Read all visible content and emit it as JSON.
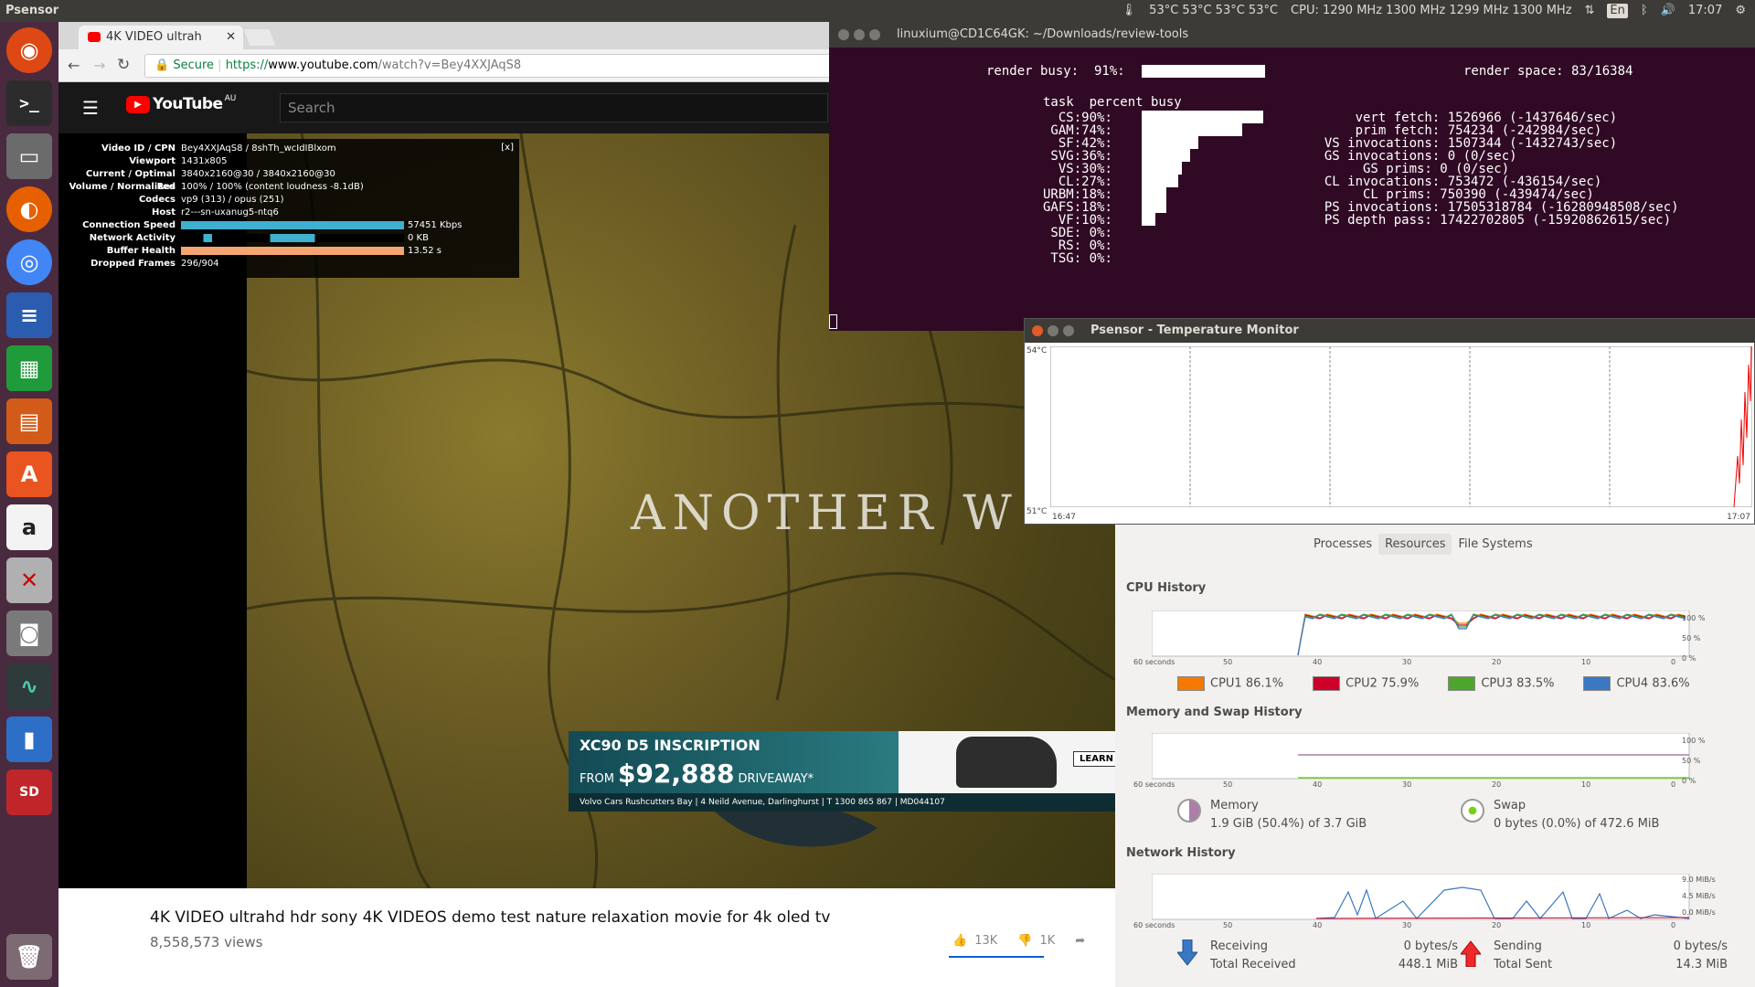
{
  "topbar": {
    "app": "Psensor",
    "temps": "53°C 53°C 53°C 53°C",
    "cpu": "CPU: 1290 MHz 1300 MHz 1299 MHz 1300 MHz",
    "lang": "En",
    "clock": "17:07"
  },
  "browser": {
    "tab_title": "4K VIDEO ultrah",
    "secure": "Secure",
    "url_scheme": "https://",
    "url_host": "www.youtube.com",
    "url_path": "/watch?v=Bey4XXJAqS8"
  },
  "youtube": {
    "logo": "YouTube",
    "region": "AU",
    "search_placeholder": "Search",
    "overlay_text": "ANOTHER W",
    "title": "4K VIDEO ultrahd hdr sony 4K VIDEOS demo test nature relaxation movie for 4k oled tv",
    "views": "8,558,573 views",
    "likes": "13K",
    "dislikes": "1K",
    "stats": [
      {
        "k": "Video ID / CPN",
        "v": "Bey4XXJAqS8 / 8shTh_wcIdIBlxom"
      },
      {
        "k": "Viewport",
        "v": "1431x805"
      },
      {
        "k": "Current / Optimal Res",
        "v": "3840x2160@30 / 3840x2160@30"
      },
      {
        "k": "Volume / Normalized",
        "v": "100% / 100% (content loudness -8.1dB)"
      },
      {
        "k": "Codecs",
        "v": "vp9 (313) / opus (251)"
      },
      {
        "k": "Host",
        "v": "r2---sn-uxanug5-ntq6"
      },
      {
        "k": "Connection Speed",
        "v": "57451 Kbps"
      },
      {
        "k": "Network Activity",
        "v": "0 KB"
      },
      {
        "k": "Buffer Health",
        "v": "13.52 s"
      },
      {
        "k": "Dropped Frames",
        "v": "296/904"
      }
    ],
    "stats_close": "[x]",
    "ad": {
      "headline": "XC90 D5 INSCRIPTION",
      "from": "FROM",
      "price": "$92,888",
      "driveaway": "DRIVEAWAY*",
      "footer": "Volvo Cars Rushcutters Bay  |  4 Neild Avenue, Darlinghurst  |  T 1300 865 867  |  MD044107",
      "cta": "LEARN"
    }
  },
  "terminal": {
    "title": "linuxium@CD1C64GK: ~/Downloads/review-tools",
    "render_busy": "render busy:  91%:",
    "render_space": "render space: 83/16384",
    "header": "task  percent busy",
    "tasks": [
      {
        "name": "  CS:",
        "pct": "90%:",
        "value": 90
      },
      {
        "name": " GAM:",
        "pct": "74%:",
        "value": 74
      },
      {
        "name": "  SF:",
        "pct": "42%:",
        "value": 42
      },
      {
        "name": " SVG:",
        "pct": "36%:",
        "value": 36
      },
      {
        "name": "  VS:",
        "pct": "30%:",
        "value": 30
      },
      {
        "name": "  CL:",
        "pct": "27%:",
        "value": 27
      },
      {
        "name": "URBM:",
        "pct": "18%:",
        "value": 18
      },
      {
        "name": "GAFS:",
        "pct": "18%:",
        "value": 18
      },
      {
        "name": "  VF:",
        "pct": "10%:",
        "value": 10
      },
      {
        "name": " SDE:",
        "pct": " 0%:",
        "value": 0
      },
      {
        "name": "  RS:",
        "pct": " 0%:",
        "value": 0
      },
      {
        "name": " TSG:",
        "pct": " 0%:",
        "value": 0
      }
    ],
    "counters": [
      "      vert fetch: 1526966 (-1437646/sec)",
      "      prim fetch: 754234 (-242984/sec)",
      "  VS invocations: 1507344 (-1432743/sec)",
      "  GS invocations: 0 (0/sec)",
      "       GS prims: 0 (0/sec)",
      "  CL invocations: 753472 (-436154/sec)",
      "       CL prims: 750390 (-439474/sec)",
      "  PS invocations: 17505318784 (-16280948508/sec)",
      "  PS depth pass: 17422702805 (-15920862615/sec)"
    ]
  },
  "psensor": {
    "title": "Psensor - Temperature Monitor",
    "ymax": "54°C",
    "ymin": "51°C",
    "xstart": "16:47",
    "xend": "17:07"
  },
  "sysmon": {
    "tabs": [
      "Processes",
      "Resources",
      "File Systems"
    ],
    "cpu_title": "CPU History",
    "mem_title": "Memory and Swap History",
    "net_title": "Network History",
    "x_ticks": [
      "60 seconds",
      "50",
      "40",
      "30",
      "20",
      "10",
      "0"
    ],
    "pct_ticks": [
      "100 %",
      "50 %",
      "0 %"
    ],
    "net_ticks": [
      "9.0 MiB/s",
      "4.5 MiB/s",
      "0.0 MiB/s"
    ],
    "cpus": [
      {
        "name": "CPU1",
        "value": "86.1%",
        "color": "#f57900"
      },
      {
        "name": "CPU2",
        "value": "75.9%",
        "color": "#cc0028"
      },
      {
        "name": "CPU3",
        "value": "83.5%",
        "color": "#4ea52c"
      },
      {
        "name": "CPU4",
        "value": "83.6%",
        "color": "#3a78c4"
      }
    ],
    "memory_label": "Memory",
    "memory_value": "1.9 GiB (50.4%) of 3.7 GiB",
    "swap_label": "Swap",
    "swap_value": "0 bytes (0.0%) of 472.6 MiB",
    "receiving": "Receiving",
    "receiving_rate": "0 bytes/s",
    "total_received": "Total Received",
    "total_received_value": "448.1 MiB",
    "sending": "Sending",
    "sending_rate": "0 bytes/s",
    "total_sent": "Total Sent",
    "total_sent_value": "14.3 MiB"
  }
}
